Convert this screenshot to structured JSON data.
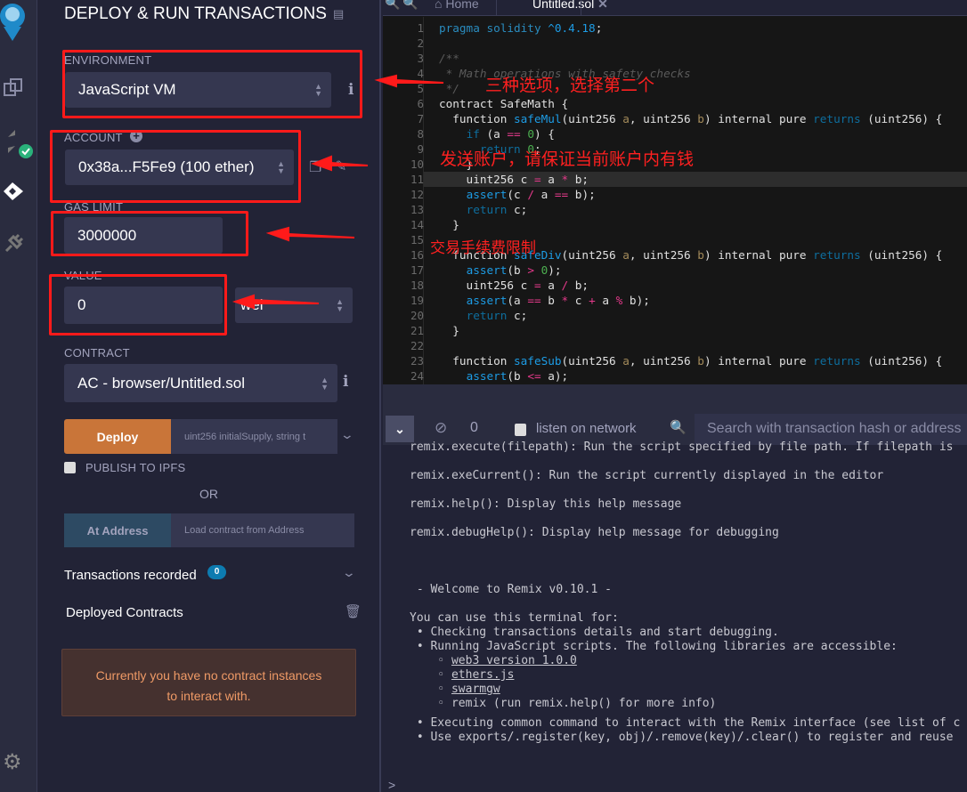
{
  "panel": {
    "title": "DEPLOY & RUN TRANSACTIONS",
    "environment": {
      "label": "ENVIRONMENT",
      "value": "JavaScript VM"
    },
    "account": {
      "label": "ACCOUNT",
      "value": "0x38a...F5Fe9 (100 ether)"
    },
    "gas_limit": {
      "label": "GAS LIMIT",
      "value": "3000000"
    },
    "value": {
      "label": "VALUE",
      "value": "0",
      "unit": "wei"
    },
    "contract": {
      "label": "CONTRACT",
      "value": "AC - browser/Untitled.sol"
    },
    "deploy": {
      "label": "Deploy",
      "params_placeholder": "uint256 initialSupply, string t"
    },
    "publish": {
      "label": "PUBLISH TO IPFS",
      "checked": false
    },
    "or": "OR",
    "at_address": {
      "label": "At Address",
      "placeholder": "Load contract from Address"
    },
    "transactions": {
      "label": "Transactions recorded",
      "count": "0"
    },
    "deployed": {
      "label": "Deployed Contracts"
    },
    "alert": {
      "line1": "Currently you have no contract instances",
      "line2": "to interact with."
    }
  },
  "tabs": [
    {
      "label": "Home"
    },
    {
      "label": "Untitled.sol",
      "active": true
    }
  ],
  "code": [
    [
      [
        "pragma solidity ",
        "pr"
      ],
      [
        "^0.4.18",
        "k"
      ],
      [
        ";",
        ""
      ]
    ],
    [],
    [
      [
        "/**",
        "cm"
      ]
    ],
    [
      [
        " * Math operations with safety checks",
        "cm"
      ]
    ],
    [
      [
        " */",
        "cm"
      ]
    ],
    [
      [
        "contract SafeMath {",
        ""
      ]
    ],
    [
      [
        "  function ",
        ""
      ],
      [
        "safeMul",
        "k"
      ],
      [
        "(uint256 ",
        ""
      ],
      [
        "a",
        "v"
      ],
      [
        ", uint256 ",
        ""
      ],
      [
        "b",
        "v"
      ],
      [
        ") internal pure ",
        ""
      ],
      [
        "returns",
        "kd"
      ],
      [
        " (uint256) {",
        ""
      ]
    ],
    [
      [
        "    ",
        ""
      ],
      [
        "if",
        "kd"
      ],
      [
        " (a ",
        ""
      ],
      [
        "==",
        "op"
      ],
      [
        " ",
        ""
      ],
      [
        "0",
        "n"
      ],
      [
        ") {",
        ""
      ]
    ],
    [
      [
        "      ",
        ""
      ],
      [
        "return",
        "kd"
      ],
      [
        " ",
        ""
      ],
      [
        "0",
        "n"
      ],
      [
        ";",
        ""
      ]
    ],
    [
      [
        "    }",
        ""
      ]
    ],
    [
      [
        "    uint256 c ",
        ""
      ],
      [
        "=",
        "op"
      ],
      [
        " a ",
        ""
      ],
      [
        "*",
        "op"
      ],
      [
        " b;",
        ""
      ]
    ],
    [
      [
        "    ",
        ""
      ],
      [
        "assert",
        "k"
      ],
      [
        "(c ",
        ""
      ],
      [
        "/",
        "op"
      ],
      [
        " a ",
        ""
      ],
      [
        "==",
        "op"
      ],
      [
        " b);",
        ""
      ]
    ],
    [
      [
        "    ",
        ""
      ],
      [
        "return",
        "kd"
      ],
      [
        " c;",
        ""
      ]
    ],
    [
      [
        "  }",
        ""
      ]
    ],
    [],
    [
      [
        "  function ",
        ""
      ],
      [
        "safeDiv",
        "k"
      ],
      [
        "(uint256 ",
        ""
      ],
      [
        "a",
        "v"
      ],
      [
        ", uint256 ",
        ""
      ],
      [
        "b",
        "v"
      ],
      [
        ") internal pure ",
        ""
      ],
      [
        "returns",
        "kd"
      ],
      [
        " (uint256) {",
        ""
      ]
    ],
    [
      [
        "    ",
        ""
      ],
      [
        "assert",
        "k"
      ],
      [
        "(b ",
        ""
      ],
      [
        ">",
        "op"
      ],
      [
        " ",
        ""
      ],
      [
        "0",
        "n"
      ],
      [
        ");",
        ""
      ]
    ],
    [
      [
        "    uint256 c ",
        ""
      ],
      [
        "=",
        "op"
      ],
      [
        " a ",
        ""
      ],
      [
        "/",
        "op"
      ],
      [
        " b;",
        ""
      ]
    ],
    [
      [
        "    ",
        ""
      ],
      [
        "assert",
        "k"
      ],
      [
        "(a ",
        ""
      ],
      [
        "==",
        "op"
      ],
      [
        " b ",
        ""
      ],
      [
        "*",
        "op"
      ],
      [
        " c ",
        ""
      ],
      [
        "+",
        "op"
      ],
      [
        " a ",
        ""
      ],
      [
        "%",
        "op"
      ],
      [
        " b);",
        ""
      ]
    ],
    [
      [
        "    ",
        ""
      ],
      [
        "return",
        "kd"
      ],
      [
        " c;",
        ""
      ]
    ],
    [
      [
        "  }",
        ""
      ]
    ],
    [],
    [
      [
        "  function ",
        ""
      ],
      [
        "safeSub",
        "k"
      ],
      [
        "(uint256 ",
        ""
      ],
      [
        "a",
        "v"
      ],
      [
        ", uint256 ",
        ""
      ],
      [
        "b",
        "v"
      ],
      [
        ") internal pure ",
        ""
      ],
      [
        "returns",
        "kd"
      ],
      [
        " (uint256) {",
        ""
      ]
    ],
    [
      [
        "    ",
        ""
      ],
      [
        "assert",
        "k"
      ],
      [
        "(b ",
        ""
      ],
      [
        "<=",
        "op"
      ],
      [
        " a);",
        ""
      ]
    ]
  ],
  "terminal": {
    "cleared_count": "0",
    "listen_label": "listen on network",
    "search_placeholder": "Search with transaction hash or address",
    "lines": [
      {
        "t": "remix.execute(filepath): Run the script specified by file path. If filepath is"
      },
      {
        "t": "remix.exeCurrent(): Run the script currently displayed in the editor"
      },
      {
        "t": "remix.help(): Display this help message"
      },
      {
        "t": "remix.debugHelp(): Display help message for debugging"
      },
      {
        "t": " - Welcome to Remix v0.10.1 -"
      },
      {
        "t": "You can use this terminal for:"
      },
      {
        "t": " • Checking transactions details and start debugging."
      },
      {
        "t": " • Running JavaScript scripts. The following libraries are accessible:"
      },
      {
        "t": "    ◦ ",
        "link": "web3 version 1.0.0"
      },
      {
        "t": "    ◦ ",
        "link": "ethers.js"
      },
      {
        "t": "    ◦ ",
        "link": "swarmgw"
      },
      {
        "t": "    ◦ remix (run remix.help() for more info)"
      },
      {
        "t": " • Executing common command to interact with the Remix interface (see list of c"
      },
      {
        "t": " • Use exports/.register(key, obj)/.remove(key)/.clear() to register and reuse"
      }
    ],
    "prompt": ">"
  },
  "annotations": {
    "env": "三种选项，选择第二个",
    "account": "发送账户，请保证当前账户内有钱",
    "gas": "交易手续费限制"
  },
  "colors": {
    "deploy": "#c97539",
    "at_address": "#2d4a63",
    "badge": "#0d7bb0",
    "annotation": "#ff1a1a",
    "alert_text": "#ef9a66"
  }
}
